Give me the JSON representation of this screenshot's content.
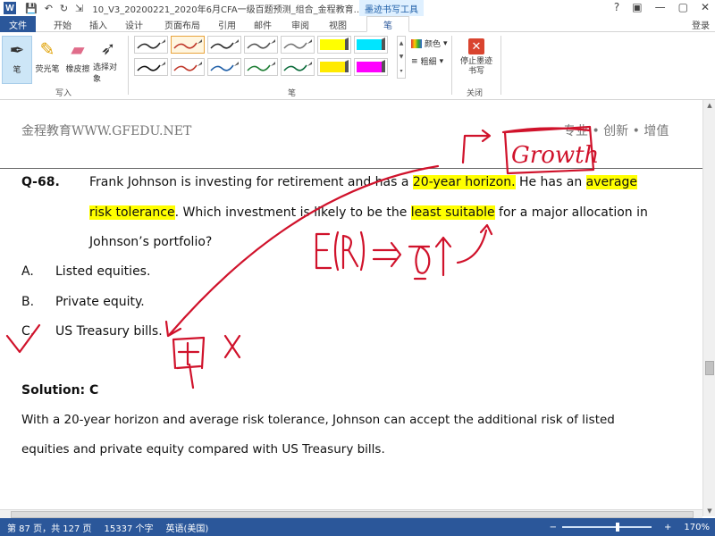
{
  "titlebar": {
    "app_icon": "W",
    "quick_access": [
      "save-icon",
      "undo-icon",
      "redo-icon"
    ],
    "doc_title": "10_V3_20200221_2020年6月CFA一级百题预测_组合_金程教育...",
    "context_tab": "墨迹书写工具",
    "controls": [
      "?",
      "▢",
      "—",
      "▢",
      "✕"
    ]
  },
  "tabs": {
    "file": "文件",
    "items": [
      "开始",
      "插入",
      "设计",
      "页面布局",
      "引用",
      "邮件",
      "审阅",
      "视图"
    ],
    "active": "笔",
    "login": "登录"
  },
  "ribbon": {
    "tools": [
      {
        "label": "笔",
        "icon": "pen-icon"
      },
      {
        "label": "荧光笔",
        "icon": "highlighter-icon"
      },
      {
        "label": "橡皮擦",
        "icon": "eraser-icon"
      },
      {
        "label": "选择对象",
        "icon": "select-cursor-icon"
      }
    ],
    "group_write": "写入",
    "group_pens": "笔",
    "color_label": "颜色",
    "weight_label": "粗细",
    "stop_label": "停止墨迹书写",
    "group_close": "关闭"
  },
  "pen_colors": [
    "#2b2b2b",
    "#c0392b",
    "#2b2b2b",
    "#555555",
    "#777777",
    "#ffff00",
    "#00e5ff",
    "#111111",
    "#c0392b",
    "#1f5fa8",
    "#1e7e34",
    "#0b6b3a",
    "#ffea00",
    "#ff00ff"
  ],
  "document": {
    "header_left": "金程教育WWW.GFEDU.NET",
    "header_right": "专业 • 创新 • 增值",
    "question_id": "Q-68.",
    "q_line1_a": "Frank Johnson is investing for retirement and has a ",
    "q_line1_hl": "20-year horizon.",
    "q_line1_b": " He has an ",
    "q_line1_hl2": "average",
    "q_line2_hl": "risk tolerance",
    "q_line2_a": ". Which investment is likely to be the ",
    "q_line2_hl2": "least suitable",
    "q_line2_b": " for a major allocation in",
    "q_line3": "Johnson’s portfolio?",
    "options": [
      {
        "letter": "A.",
        "text": "Listed equities."
      },
      {
        "letter": "B.",
        "text": "Private equity."
      },
      {
        "letter": "C.",
        "text": "US Treasury bills."
      }
    ],
    "solution_title": "Solution: C",
    "solution_line1": "With a 20-year horizon and average risk tolerance, Johnson can accept the additional risk of listed",
    "solution_line2": "equities and private equity compared with US Treasury bills."
  },
  "ink_annotations": {
    "word_growth": "Growth",
    "formula": "E(R) => σ↑",
    "note_c": "固 X",
    "color": "#d0122b"
  },
  "statusbar": {
    "page": "第 87 页，共 127 页",
    "words": "15337 个字",
    "language": "英语(美国)",
    "zoom": "170%"
  }
}
